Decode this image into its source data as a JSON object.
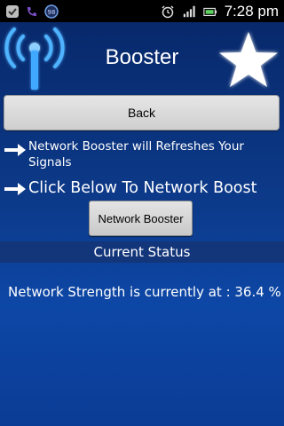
{
  "status_bar": {
    "time": "7:28 pm",
    "notification_badge": "98",
    "icons": [
      "check-notification-icon",
      "voicemail-icon",
      "app-badge-icon",
      "alarm-clock-icon",
      "signal-strength-icon",
      "battery-icon"
    ]
  },
  "header": {
    "title": "Booster",
    "icons": [
      "signal-tower-icon",
      "star-icon"
    ]
  },
  "buttons": {
    "back_label": "Back",
    "boost_label": "Network Booster"
  },
  "info": {
    "line1": "Network Booster will Refreshes Your Signals",
    "line2": "Click Below To Network Boost"
  },
  "status": {
    "header": "Current Status",
    "strength_text": "Network Strength is currently at : 36.4 %",
    "strength_percent": 36.4
  },
  "colors": {
    "background_top": "#08296b",
    "background_bottom": "#0d47a6",
    "status_header_bg": "#13357a",
    "button_bg": "#d8d8d8",
    "glow_blue": "#3fa9ff"
  }
}
